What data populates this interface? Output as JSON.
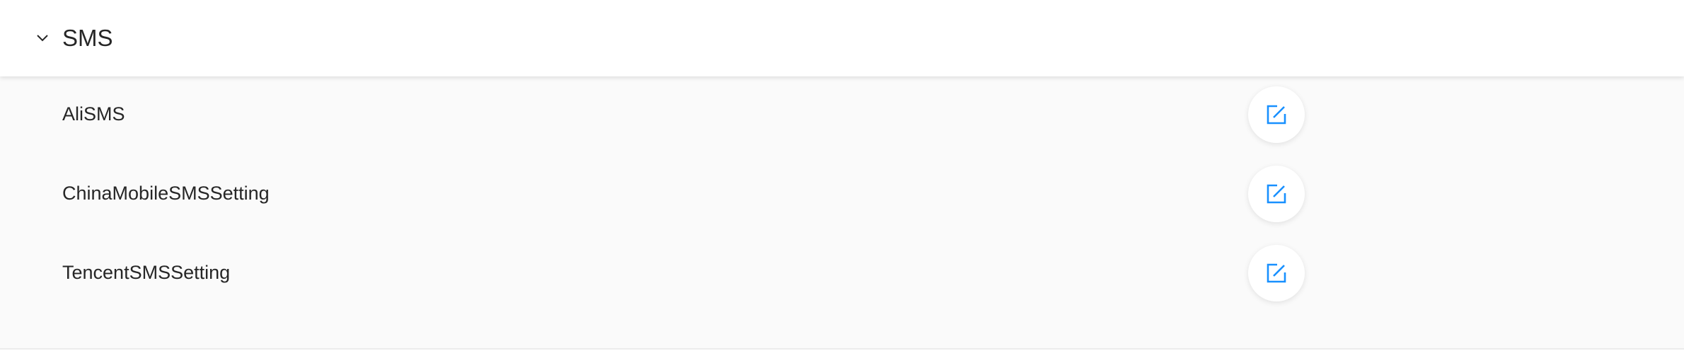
{
  "section": {
    "title": "SMS",
    "expanded": true,
    "toggle_icon": "chevron-down-icon"
  },
  "items": [
    {
      "label": "AliSMS",
      "action_icon": "edit-icon"
    },
    {
      "label": "ChinaMobileSMSSetting",
      "action_icon": "edit-icon"
    },
    {
      "label": "TencentSMSSetting",
      "action_icon": "edit-icon"
    }
  ],
  "colors": {
    "accent": "#1890ff",
    "body_background": "#fafafa",
    "text": "#262626"
  }
}
